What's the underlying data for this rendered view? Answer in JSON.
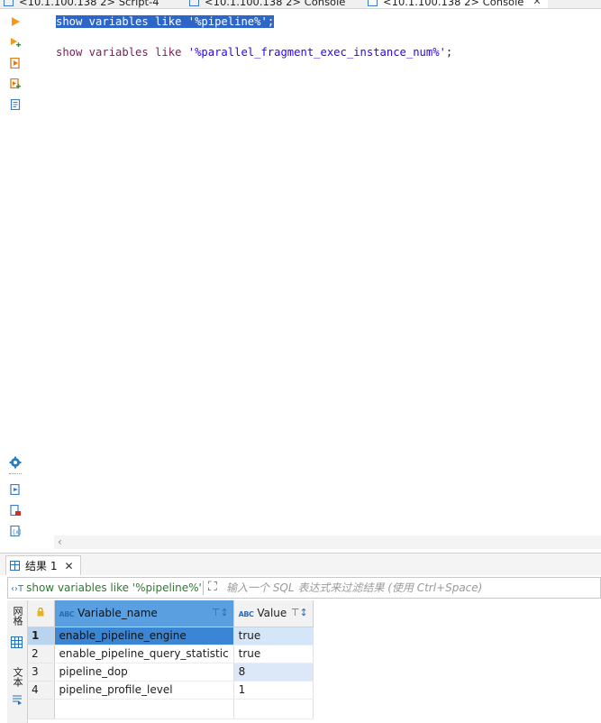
{
  "editor_tabs": [
    {
      "label": "<10.1.100.138 2> Script-4",
      "active": false
    },
    {
      "label": "<10.1.100.138 2> Console",
      "active": false
    },
    {
      "label": "<10.1.100.138 2> Console",
      "active": true
    }
  ],
  "sql_lines": [
    {
      "kw": "show variables like ",
      "str": "'%pipeline%'",
      "end": ";",
      "selected": true
    },
    {
      "kw": "show variables like ",
      "str": "'%parallel_fragment_exec_instance_num%'",
      "end": ";",
      "selected": false
    }
  ],
  "results": {
    "tab_label": "结果 1",
    "filter": {
      "query_text": "show variables like '%pipeline%'",
      "placeholder": "输入一个 SQL 表达式来过滤结果 (使用 Ctrl+Space)"
    },
    "side_tabs": [
      "网格",
      "文本"
    ],
    "columns": [
      "Variable_name",
      "Value"
    ],
    "rows": [
      {
        "n": "1",
        "name": "enable_pipeline_engine",
        "value": "true"
      },
      {
        "n": "2",
        "name": "enable_pipeline_query_statistic",
        "value": "true"
      },
      {
        "n": "3",
        "name": "pipeline_dop",
        "value": "8"
      },
      {
        "n": "4",
        "name": "pipeline_profile_level",
        "value": "1"
      }
    ]
  },
  "colors": {
    "selection": "#2e66c8",
    "keyword": "#7a1d5a",
    "string": "#2a00ff",
    "header_selected": "#5a9fe0"
  },
  "icons": {
    "left_toolbar": [
      "execute-icon",
      "execute-statement-icon",
      "execute-script-icon",
      "execute-script-new-tab-icon",
      "explain-plan-icon"
    ],
    "left_toolbar_bottom": [
      "settings-icon",
      "export-icon",
      "file-lock-icon",
      "variables-icon"
    ]
  }
}
